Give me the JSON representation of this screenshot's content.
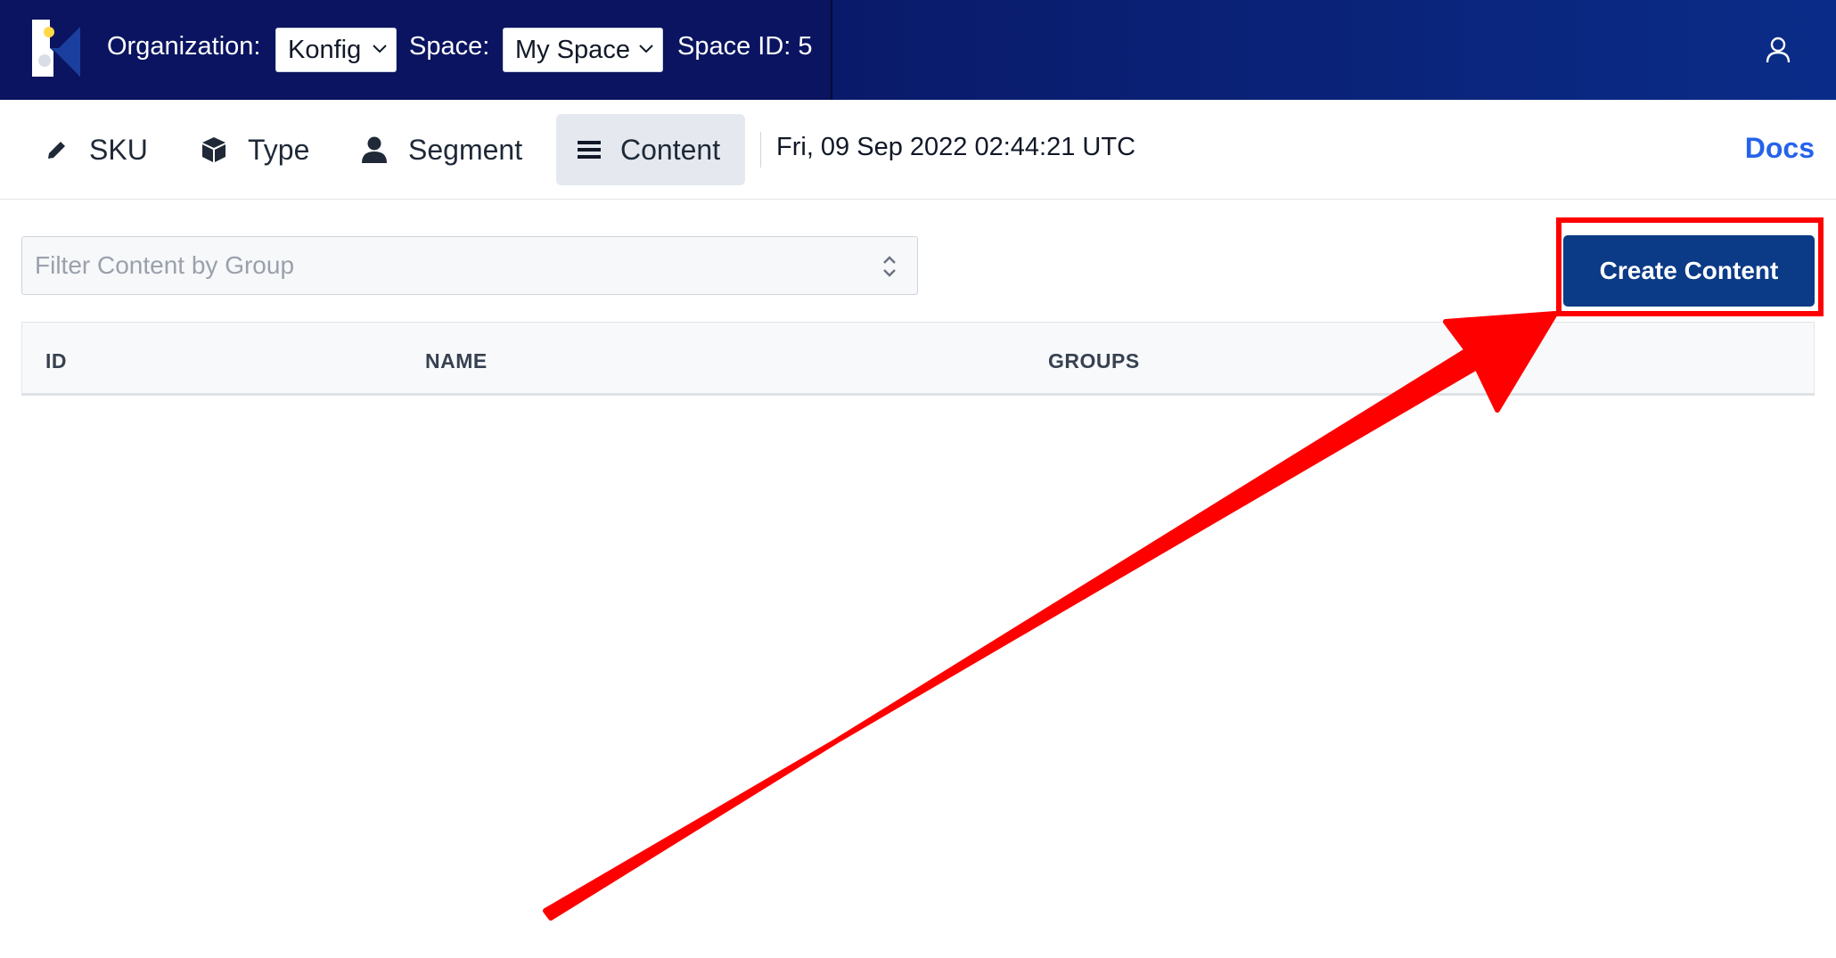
{
  "header": {
    "organization_label": "Organization:",
    "organization_value": "Konfig",
    "space_label": "Space:",
    "space_value": "My Space",
    "space_id": "Space ID: 5",
    "user_icon": "user-icon"
  },
  "nav": {
    "items": [
      {
        "label": "SKU",
        "icon": "pencil-icon"
      },
      {
        "label": "Type",
        "icon": "cube-icon"
      },
      {
        "label": "Segment",
        "icon": "user-icon"
      },
      {
        "label": "Content",
        "icon": "list-icon",
        "active": true
      }
    ],
    "timestamp": "Fri, 09 Sep 2022 02:44:21 UTC",
    "docs_label": "Docs"
  },
  "filter": {
    "placeholder": "Filter Content by Group"
  },
  "actions": {
    "create_label": "Create Content"
  },
  "table": {
    "columns": [
      "ID",
      "NAME",
      "GROUPS"
    ],
    "rows": []
  },
  "colors": {
    "topbar": "#0a1460",
    "primary_button": "#0b3a86",
    "link": "#2563eb",
    "annotation": "#ff0000"
  }
}
